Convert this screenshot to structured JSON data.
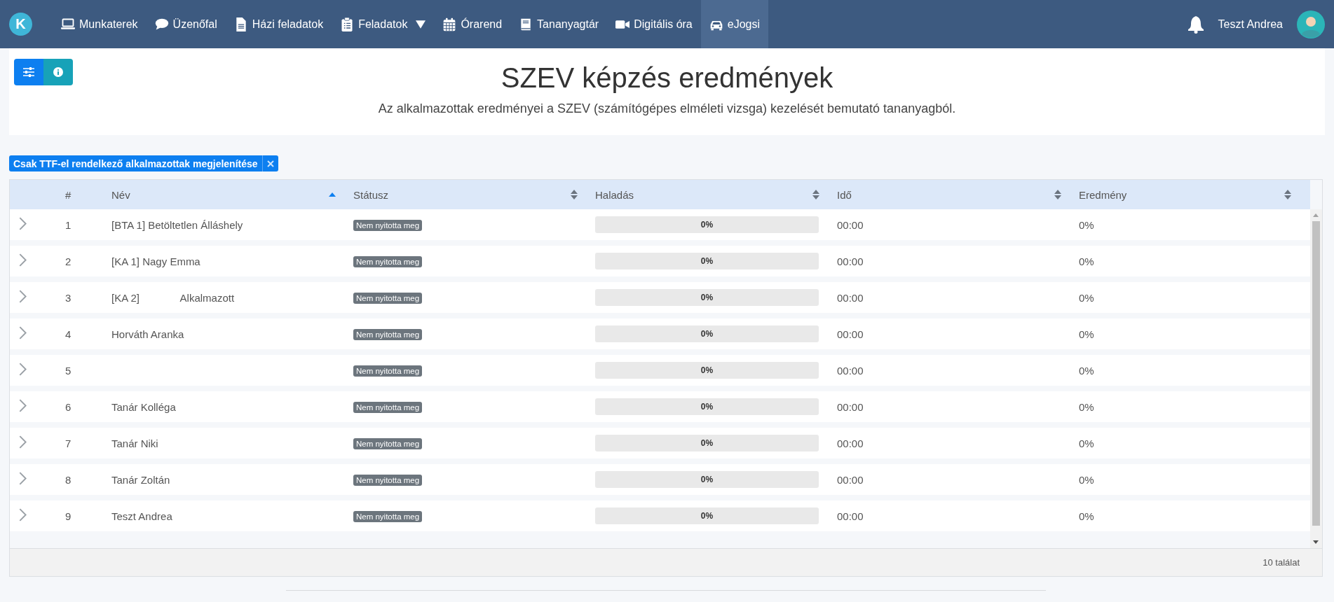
{
  "nav": {
    "logo": "K",
    "items": [
      {
        "label": "Munkaterek",
        "kind": "laptop",
        "dropdown": false,
        "selected": false
      },
      {
        "label": "Üzenőfal",
        "kind": "comment",
        "dropdown": false,
        "selected": false
      },
      {
        "label": "Házi feladatok",
        "kind": "file",
        "dropdown": false,
        "selected": false
      },
      {
        "label": "Feladatok",
        "kind": "clipboard",
        "dropdown": true,
        "selected": false
      },
      {
        "label": "Órarend",
        "kind": "calendar",
        "dropdown": false,
        "selected": false
      },
      {
        "label": "Tananyagtár",
        "kind": "book",
        "dropdown": false,
        "selected": false
      },
      {
        "label": "Digitális óra",
        "kind": "video",
        "dropdown": false,
        "selected": false
      },
      {
        "label": "eJogsi",
        "kind": "car",
        "dropdown": false,
        "selected": true
      }
    ],
    "user": {
      "name": "Teszt Andrea"
    }
  },
  "header": {
    "title": "SZEV képzés eredmények",
    "subtitle": "Az alkalmazottak eredményei a SZEV (számítógépes elméleti vizsga) kezelését bemutató tananyagból."
  },
  "filter_chip": {
    "label": "Csak TTF-el rendelkező alkalmazottak megjelenítése"
  },
  "table": {
    "columns": [
      {
        "label": "#",
        "kind": "plain"
      },
      {
        "label": "Név",
        "kind": "sorted"
      },
      {
        "label": "Státusz",
        "kind": "sortable"
      },
      {
        "label": "Haladás",
        "kind": "sortable"
      },
      {
        "label": "Idő",
        "kind": "sortable"
      },
      {
        "label": "Eredmény",
        "kind": "sortable"
      }
    ],
    "rows": [
      {
        "number": "1",
        "name": "[BTA 1] Betöltetlen Álláshely",
        "status": "Nem nyitotta meg",
        "progress": {
          "level": 0,
          "reading": "0%"
        },
        "time": "00:00",
        "result": "0%"
      },
      {
        "number": "2",
        "name": "[KA 1] Nagy Emma",
        "status": "Nem nyitotta meg",
        "progress": {
          "level": 0,
          "reading": "0%"
        },
        "time": "00:00",
        "result": "0%"
      },
      {
        "number": "3",
        "name": "[KA 2]              Alkalmazott",
        "status": "Nem nyitotta meg",
        "progress": {
          "level": 0,
          "reading": "0%"
        },
        "time": "00:00",
        "result": "0%"
      },
      {
        "number": "4",
        "name": "Horváth Aranka",
        "status": "Nem nyitotta meg",
        "progress": {
          "level": 0,
          "reading": "0%"
        },
        "time": "00:00",
        "result": "0%"
      },
      {
        "number": "5",
        "status": "Nem nyitotta meg",
        "progress": {
          "level": 0,
          "reading": "0%"
        },
        "time": "00:00",
        "result": "0%"
      },
      {
        "number": "6",
        "name": "Tanár Kolléga",
        "status": "Nem nyitotta meg",
        "progress": {
          "level": 0,
          "reading": "0%"
        },
        "time": "00:00",
        "result": "0%"
      },
      {
        "number": "7",
        "name": "Tanár Niki",
        "status": "Nem nyitotta meg",
        "progress": {
          "level": 0,
          "reading": "0%"
        },
        "time": "00:00",
        "result": "0%"
      },
      {
        "number": "8",
        "name": "Tanár Zoltán",
        "status": "Nem nyitotta meg",
        "progress": {
          "level": 0,
          "reading": "0%"
        },
        "time": "00:00",
        "result": "0%"
      },
      {
        "number": "9",
        "name": "Teszt Andrea",
        "status": "Nem nyitotta meg",
        "progress": {
          "level": 0,
          "reading": "0%"
        },
        "time": "00:00",
        "result": "0%"
      }
    ],
    "footer": "10 találat"
  }
}
